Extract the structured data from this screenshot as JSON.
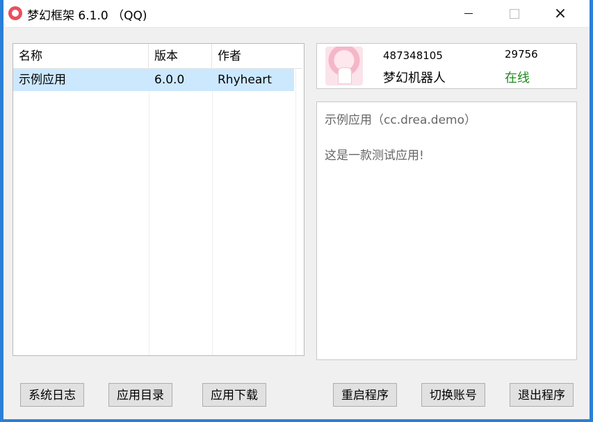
{
  "window": {
    "title": "梦幻框架 6.1.0 （QQ)",
    "controls": {
      "minimize": "minimize",
      "maximize": "maximize",
      "close": "×"
    }
  },
  "list": {
    "headers": [
      "名称",
      "版本",
      "作者"
    ],
    "rows": [
      {
        "name": "示例应用",
        "version": "6.0.0",
        "author": "Rhyheart",
        "selected": true
      }
    ]
  },
  "account": {
    "qq": "487348105",
    "number": "29756",
    "nickname": "梦幻机器人",
    "status": "在线",
    "status_color": "#1f8a1f"
  },
  "detail": {
    "title": "示例应用（cc.drea.demo）",
    "description": "这是一款测试应用!"
  },
  "buttons": {
    "system_log": "系统日志",
    "app_directory": "应用目录",
    "app_download": "应用下载",
    "restart": "重启程序",
    "switch_account": "切换账号",
    "exit": "退出程序"
  },
  "colors": {
    "accent": "#2b7fd6",
    "selection": "#cce8ff"
  }
}
